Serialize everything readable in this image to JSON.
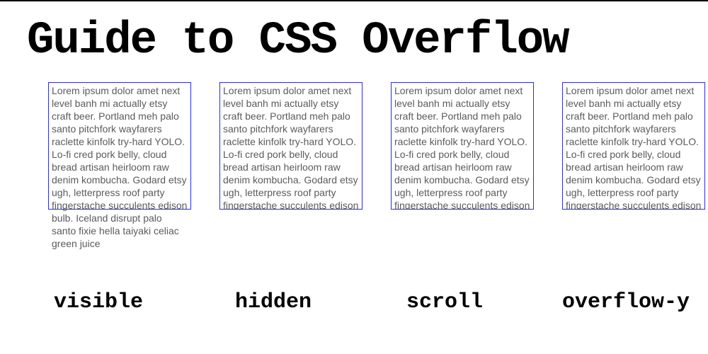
{
  "title": "Guide to CSS Overflow",
  "lorem_full": "Lorem ipsum dolor amet next level banh mi actually etsy craft beer. Portland meh palo santo pitchfork wayfarers raclette kinfolk try-hard YOLO. Lo-fi cred pork belly, cloud bread artisan heirloom raw denim kombucha. Godard etsy ugh, letterpress roof party fingerstache succulents edison bulb. Iceland disrupt palo santo fixie hella taiyaki celiac green juice",
  "examples": [
    {
      "mode": "visible",
      "label": "visible"
    },
    {
      "mode": "hidden",
      "label": "hidden"
    },
    {
      "mode": "scroll",
      "label": "scroll"
    },
    {
      "mode": "overflow-y",
      "label": "overflow-y"
    }
  ]
}
